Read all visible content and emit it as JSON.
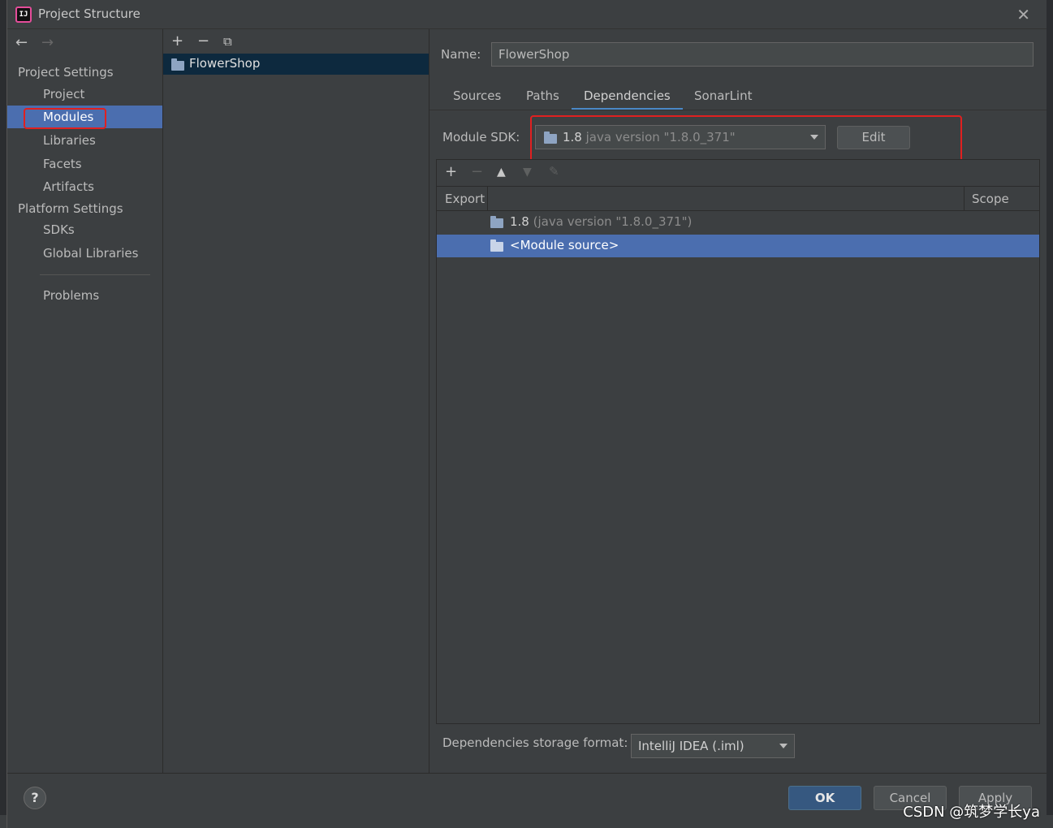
{
  "window": {
    "title": "Project Structure",
    "logo_text": "IJ"
  },
  "leftnav": {
    "section_project": "Project Settings",
    "project_items": [
      "Project",
      "Modules",
      "Libraries",
      "Facets",
      "Artifacts"
    ],
    "section_platform": "Platform Settings",
    "platform_items": [
      "SDKs",
      "Global Libraries"
    ],
    "problems": "Problems",
    "selected": "Modules"
  },
  "modules": {
    "items": [
      "FlowerShop"
    ]
  },
  "content": {
    "name_label": "Name:",
    "name_value": "FlowerShop",
    "tabs": [
      "Sources",
      "Paths",
      "Dependencies",
      "SonarLint"
    ],
    "active_tab": "Dependencies",
    "sdk_label": "Module SDK:",
    "sdk_version": "1.8",
    "sdk_detail": "java version \"1.8.0_371\"",
    "edit_label": "Edit",
    "table_headers": {
      "export": "Export",
      "scope": "Scope"
    },
    "dependencies": [
      {
        "name": "1.8",
        "detail": "(java version \"1.8.0_371\")",
        "selected": false
      },
      {
        "name": "<Module source>",
        "detail": "",
        "selected": true
      }
    ],
    "storage_label": "Dependencies storage format:",
    "storage_value": "IntelliJ IDEA (.iml)"
  },
  "buttons": {
    "help": "?",
    "ok": "OK",
    "cancel": "Cancel",
    "apply": "Apply"
  },
  "watermark": "CSDN @筑梦学长ya",
  "colors": {
    "selection": "#4b6eaf",
    "annotation_red": "#e02020",
    "primary_button": "#365880"
  }
}
